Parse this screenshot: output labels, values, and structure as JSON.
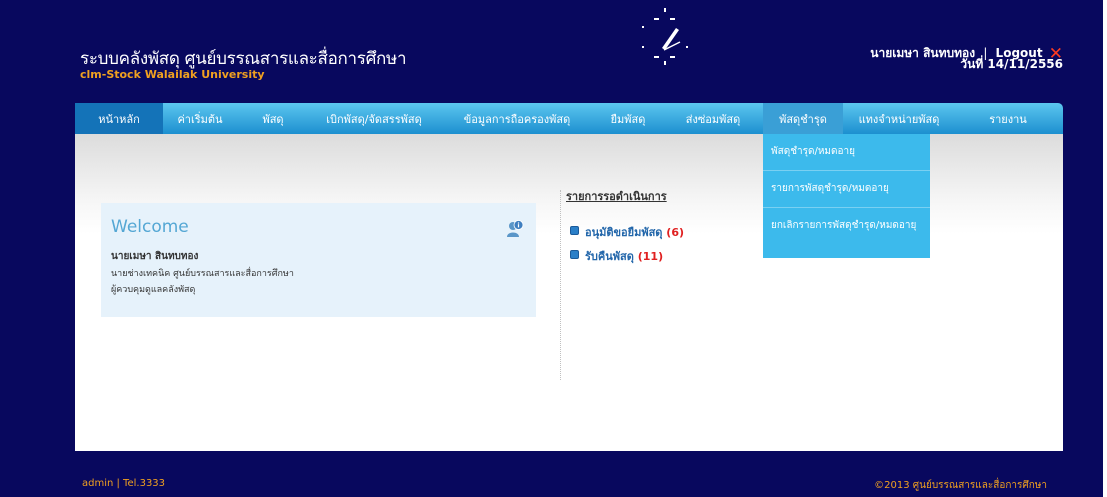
{
  "header": {
    "title": "ระบบคลังพัสดุ ศูนย์บรรณสารและสื่อการศึกษา",
    "subtitle": "clm-Stock Walailak University",
    "user_name": "นายเมษา สินทบทอง",
    "separator": "|",
    "logout_label": "Logout",
    "date": "วันที่ 14/11/2556",
    "logout_icon": "close-icon"
  },
  "nav": {
    "items": [
      {
        "label": "หน้าหลัก"
      },
      {
        "label": "ค่าเริ่มต้น"
      },
      {
        "label": "พัสดุ"
      },
      {
        "label": "เบิกพัสดุ/จัดสรรพัสดุ"
      },
      {
        "label": "ข้อมูลการถือครองพัสดุ"
      },
      {
        "label": "ยืมพัสดุ"
      },
      {
        "label": "ส่งซ่อมพัสดุ"
      },
      {
        "label": "พัสดุชำรุด"
      },
      {
        "label": "แทงจำหน่ายพัสดุ"
      },
      {
        "label": "รายงาน"
      }
    ],
    "dropdown": [
      {
        "label": "พัสดุชำรุด/หมดอายุ"
      },
      {
        "label": "รายการพัสดุชำรุด/หมดอายุ"
      },
      {
        "label": "ยกเลิกรายการพัสดุชำรุด/หมดอายุ"
      }
    ]
  },
  "welcome": {
    "title": "Welcome",
    "name": "นายเมษา สินทบทอง",
    "position": "นายช่างเทคนิค ศูนย์บรรณสารและสื่อการศึกษา",
    "role": "ผู้ควบคุมดูแลคลังพัสดุ",
    "icon": "info-user-icon"
  },
  "pending": {
    "title": "รายการรอดำเนินการ",
    "items": [
      {
        "label": "อนุมัติขอยืมพัสดุ",
        "count": "(6)"
      },
      {
        "label": "รับคืนพัสดุ",
        "count": "(11)"
      }
    ]
  },
  "footer": {
    "left": "admin | Tel.3333",
    "right": "©2013 ศูนย์บรรณสารและสื่อการศึกษา"
  },
  "colors": {
    "navy": "#08085e",
    "accent": "#f0a020",
    "nav_blue": "#3cbaec"
  }
}
